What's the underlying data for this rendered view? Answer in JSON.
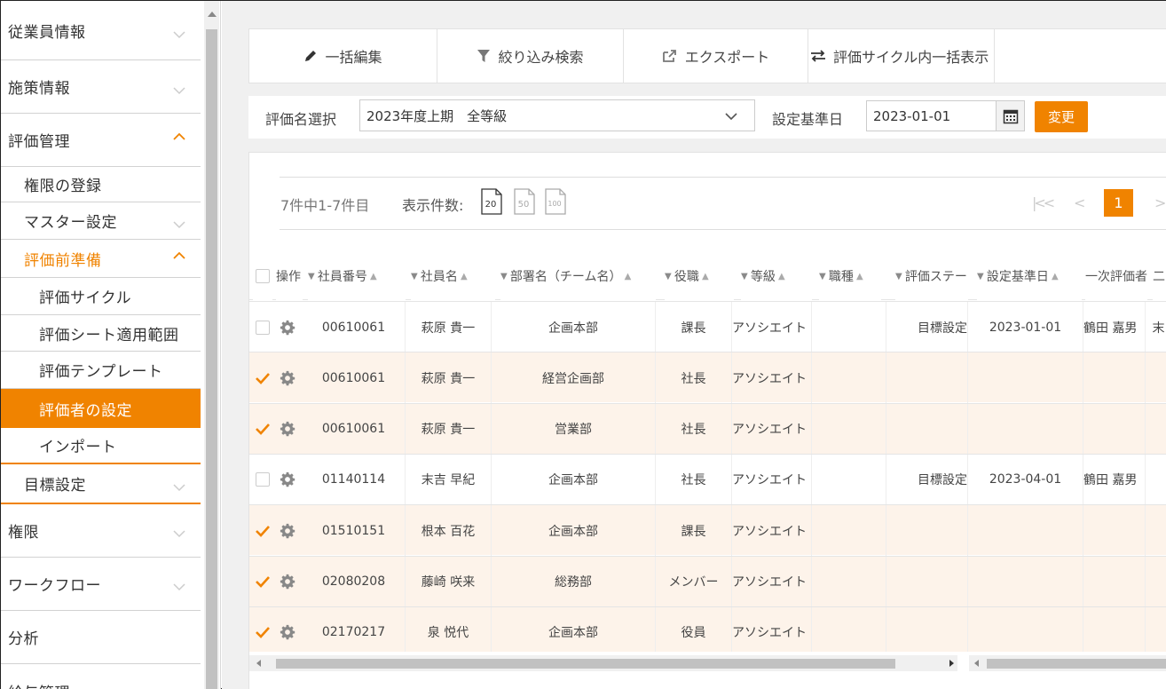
{
  "sidebar": {
    "items": [
      {
        "label": "従業員情報"
      },
      {
        "label": "施策情報"
      },
      {
        "label": "評価管理"
      },
      {
        "label": "権限の登録"
      },
      {
        "label": "マスター設定"
      },
      {
        "label": "評価前準備"
      },
      {
        "label": "評価サイクル"
      },
      {
        "label": "評価シート適用範囲"
      },
      {
        "label": "評価テンプレート"
      },
      {
        "label": "評価者の設定"
      },
      {
        "label": "インポート"
      },
      {
        "label": "目標設定"
      },
      {
        "label": "権限"
      },
      {
        "label": "ワークフロー"
      },
      {
        "label": "分析"
      },
      {
        "label": "給与管理"
      }
    ]
  },
  "toolbar": {
    "bulk_edit": "一括編集",
    "filter_search": "絞り込み検索",
    "export": "エクスポート",
    "cycle_bulk_view": "評価サイクル内一括表示"
  },
  "filter": {
    "eval_label": "評価名選択",
    "eval_value": "2023年度上期　全等級",
    "date_label": "設定基準日",
    "date_value": "2023-01-01",
    "change_button": "変更"
  },
  "pager": {
    "count_text": "7件中1-7件目",
    "per_page_label": "表示件数:",
    "per_page_options": [
      "20",
      "50",
      "100"
    ],
    "first": "|<<",
    "prev": "<",
    "current_page": "1",
    "next": ">"
  },
  "table": {
    "headers": {
      "action": "操作",
      "emp_no": "社員番号",
      "emp_name": "社員名",
      "dept": "部署名（チーム名）",
      "position": "役職",
      "grade": "等級",
      "job_type": "職種",
      "eval_status": "評価ステータス",
      "base_date": "設定基準日",
      "first_evaluator": "一次評価者",
      "second_evaluator": "二"
    },
    "rows": [
      {
        "checked": false,
        "emp_no": "00610061",
        "name": "萩原 貴一",
        "dept": "企画本部",
        "position": "課長",
        "grade": "アソシエイト",
        "job_type": "",
        "status": "目標設定",
        "base_date": "2023-01-01",
        "first_eval": "鶴田 嘉男",
        "second_eval": "末"
      },
      {
        "checked": true,
        "emp_no": "00610061",
        "name": "萩原 貴一",
        "dept": "経営企画部",
        "position": "社長",
        "grade": "アソシエイト",
        "job_type": "",
        "status": "",
        "base_date": "",
        "first_eval": "",
        "second_eval": ""
      },
      {
        "checked": true,
        "emp_no": "00610061",
        "name": "萩原 貴一",
        "dept": "営業部",
        "position": "社長",
        "grade": "アソシエイト",
        "job_type": "",
        "status": "",
        "base_date": "",
        "first_eval": "",
        "second_eval": ""
      },
      {
        "checked": false,
        "emp_no": "01140114",
        "name": "末吉 早紀",
        "dept": "企画本部",
        "position": "社長",
        "grade": "アソシエイト",
        "job_type": "",
        "status": "目標設定",
        "base_date": "2023-04-01",
        "first_eval": "鶴田 嘉男",
        "second_eval": ""
      },
      {
        "checked": true,
        "emp_no": "01510151",
        "name": "根本 百花",
        "dept": "企画本部",
        "position": "課長",
        "grade": "アソシエイト",
        "job_type": "",
        "status": "",
        "base_date": "",
        "first_eval": "",
        "second_eval": ""
      },
      {
        "checked": true,
        "emp_no": "02080208",
        "name": "藤崎 咲来",
        "dept": "総務部",
        "position": "メンバー",
        "grade": "アソシエイト",
        "job_type": "",
        "status": "",
        "base_date": "",
        "first_eval": "",
        "second_eval": ""
      },
      {
        "checked": true,
        "emp_no": "02170217",
        "name": "泉 悦代",
        "dept": "企画本部",
        "position": "役員",
        "grade": "アソシエイト",
        "job_type": "",
        "status": "",
        "base_date": "",
        "first_eval": "",
        "second_eval": ""
      }
    ]
  },
  "colors": {
    "accent": "#f08300",
    "checked_row": "#fdf3ea"
  }
}
